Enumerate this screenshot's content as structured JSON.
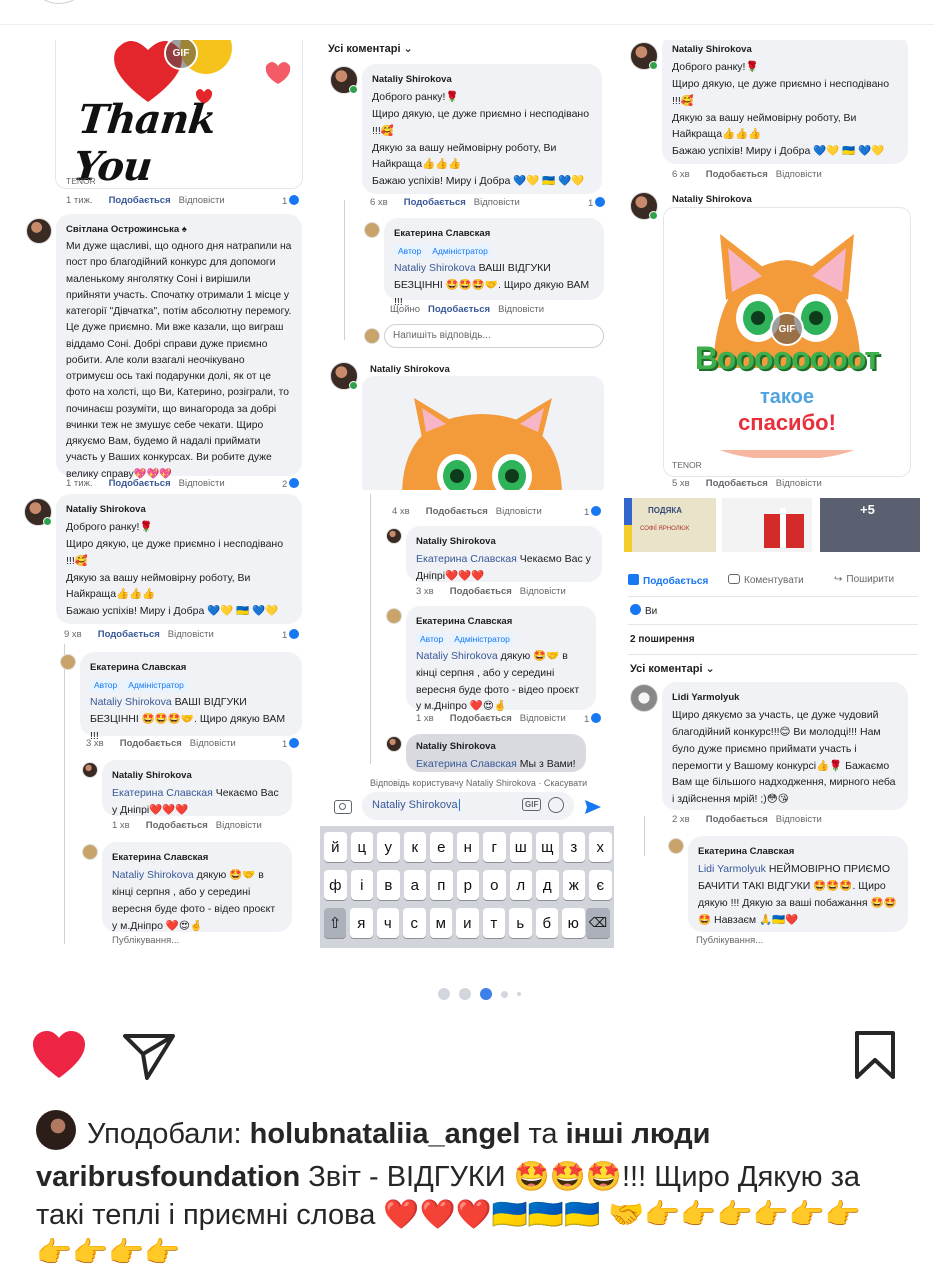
{
  "carousel": {
    "p1": {
      "tenor": "TENOR",
      "gif_label": "GIF",
      "thank_you": "Thank You",
      "meta1": {
        "time": "1 тиж.",
        "like": "Подобається",
        "reply": "Відповісти",
        "count": "1"
      },
      "comment": {
        "name": "Світлана Острожинська ♠",
        "text": "Ми дуже щасливі, що одного дня натрапили на пост про благодійний конкурс для допомоги маленькому янголятку Соні і вирішили прийняти участь.   Спочатку отримали 1 місце у категорії \"Дівчатка\", потім абсолютну перемогу. Це дуже приємно. Ми вже казали, що виграш віддамо Соні. Добрі справи дуже приємно робити. Але коли взагалі неочікувано отримуєш ось такі подарунки долі, як от це фото на холсті, що Ви, Катерино, розіграли, то починаєш розуміти, що винагорода за добрі вчинки теж не змушує себе чекати. Щиро дякуємо Вам, будемо й надалі приймати участь у Ваших конкурсах. Ви робите дуже велику справу💖💖💖"
      },
      "meta2": {
        "time": "1 тиж.",
        "like": "Подобається",
        "reply": "Відповісти",
        "count": "2"
      }
    },
    "p2": {
      "all_comments": "Усі коментарі ⌄",
      "comment": {
        "name": "Nataliy Shirokova",
        "lines": [
          "Доброго ранку!🌹",
          "Щиро дякую, це дуже приємно і несподівано !!!🥰",
          "Дякую за вашу неймовірну роботу, Ви Найкраща👍👍👍",
          "Бажаю успіхів! Миру і Добра 💙💛 🇺🇦 💙💛"
        ]
      },
      "meta1": {
        "time": "6 хв",
        "like": "Подобається",
        "reply": "Відповісти",
        "count": "1"
      },
      "reply": {
        "name": "Екатерина Славская",
        "badge1": "Автор",
        "badge2": "Адміністратор",
        "mention": "Nataliy Shirokova",
        "text": " ВАШІ ВІДГУКИ БЕЗЦІННІ 🤩🤩🤩🤝. Щиро дякую ВАМ !!!"
      },
      "meta2": {
        "time": "Щойно",
        "like": "Подобається",
        "reply": "Відповісти"
      },
      "reply_placeholder": "Напишіть відповідь...",
      "comment2_name": "Nataliy Shirokova"
    },
    "p3": {
      "comment": {
        "name": "Nataliy Shirokova",
        "lines": [
          "Доброго ранку!🌹",
          "Щиро дякую, це дуже приємно і несподівано !!!🥰",
          "Дякую за вашу неймовірну роботу, Ви Найкраща👍👍👍",
          "Бажаю успіхів! Миру і Добра 💙💛 🇺🇦 💙💛"
        ]
      },
      "meta1": {
        "time": "6 хв",
        "like": "Подобається",
        "reply": "Відповісти"
      },
      "comment2_name": "Nataliy Shirokova",
      "gif_line1": "Воооооооот",
      "gif_line2": "такое",
      "gif_line3": "спасибо!",
      "gif_label": "GIF",
      "tenor": "TENOR",
      "meta2": {
        "time": "5 хв",
        "like": "Подобається",
        "reply": "Відповісти"
      }
    },
    "p4": {
      "comment": {
        "name": "Nataliy Shirokova",
        "lines": [
          "Доброго ранку!🌹",
          "Щиро дякую, це дуже приємно і несподівано !!!🥰",
          "Дякую за вашу неймовірну роботу, Ви Найкраща👍👍👍",
          "Бажаю успіхів! Миру і Добра 💙💛 🇺🇦 💙💛"
        ]
      },
      "meta1": {
        "time": "9 хв",
        "like": "Подобається",
        "reply": "Відповісти",
        "count": "1"
      },
      "reply1": {
        "name": "Екатерина Славская",
        "badge1": "Автор",
        "badge2": "Адміністратор",
        "mention": "Nataliy Shirokova",
        "text": " ВАШІ ВІДГУКИ БЕЗЦІННІ 🤩🤩🤩🤝. Щиро дякую ВАМ !!!"
      },
      "meta2": {
        "time": "3 хв",
        "like": "Подобається",
        "reply": "Відповісти",
        "count": "1"
      },
      "reply2": {
        "name": "Nataliy Shirokova",
        "mention": "Екатерина Славская",
        "text": " Чекаємо Вас у Дніпрі❤️❤️❤️"
      },
      "meta3": {
        "time": "1 хв",
        "like": "Подобається",
        "reply": "Відповісти"
      },
      "reply3": {
        "name": "Екатерина Славская",
        "mention": "Nataliy Shirokova",
        "text": " дякую 🤩🤝 в кінці серпня , або у середині вересня буде фото - відео проєкт у м.Дніпро ❤️😍🤞"
      },
      "publishing": "Публікування..."
    },
    "p5": {
      "meta0": {
        "time": "4 хв",
        "like": "Подобається",
        "reply": "Відповісти",
        "count": "1"
      },
      "reply1": {
        "name": "Nataliy Shirokova",
        "mention": "Екатерина Славская",
        "text": " Чекаємо Вас у Дніпрі❤️❤️❤️"
      },
      "meta1": {
        "time": "3 хв",
        "like": "Подобається",
        "reply": "Відповісти"
      },
      "reply2": {
        "name": "Екатерина Славская",
        "badge1": "Автор",
        "badge2": "Адміністратор",
        "mention": "Nataliy Shirokova",
        "text": " дякую 🤩🤝 в кінці серпня , або у середині вересня буде фото - відео проєкт у м.Дніпро ❤️😍🤞"
      },
      "meta2": {
        "time": "1 хв",
        "like": "Подобається",
        "reply": "Відповісти",
        "count": "1"
      },
      "reply3": {
        "name": "Nataliy Shirokova",
        "mention": "Екатерина Славская",
        "text": " Мы з Вами!"
      },
      "replying_to": "Відповідь користувачу Nataliy Shirokova · Скасувати",
      "input_value": "Nataliy Shirokova",
      "gif": "GIF",
      "keys_row1": [
        "й",
        "ц",
        "у",
        "к",
        "е",
        "н",
        "г",
        "ш",
        "щ",
        "з",
        "х"
      ],
      "keys_row2": [
        "ф",
        "і",
        "в",
        "а",
        "п",
        "р",
        "о",
        "л",
        "д",
        "ж",
        "є"
      ],
      "keys_row3": [
        "я",
        "ч",
        "с",
        "м",
        "и",
        "т",
        "ь",
        "б",
        "ю"
      ]
    },
    "p6": {
      "thumb_more": "+5",
      "thumb_title": "ПОДЯКА",
      "thumb_name": "СОФІЇ ЯРНОЛЮК",
      "action_like": "Подобається",
      "action_comment": "Коментувати",
      "action_share": "Поширити",
      "reactions": "Ви",
      "shares": "2 поширення",
      "all_comments": "Усі коментарі ⌄",
      "comment": {
        "name": "Lidi Yarmolyuk",
        "text": "Щиро дякуємо за участь, це дуже чудовий благодійний конкурс!!!😊 Ви молодці!!! Нам було дуже приємно приймати участь і перемогти у Вашому конкурсі👍🌹 Бажаємо Вам ще більшого надходження, мирного неба і здійснення мрій! ;)😳😘"
      },
      "meta1": {
        "time": "2 хв",
        "like": "Подобається",
        "reply": "Відповісти"
      },
      "reply": {
        "name": "Екатерина Славская",
        "mention": "Lidi Yarmolyuk",
        "text": " НЕЙМОВІРНО ПРИЄМО БАЧИТИ ТАКІ ВІДГУКИ 🤩🤩🤩. Щиро дякую !!! Дякую за ваші побажання 🤩🤩🤩 Навзаєм 🙏🇺🇦❤️"
      },
      "publishing": "Публікування..."
    }
  },
  "carousel_dots": 5,
  "liked_by": {
    "prefix": "Уподобали: ",
    "user": "holubnataliia_angel",
    "middle": " та ",
    "others": "інші люди"
  },
  "caption": {
    "account": "varibrusfoundation",
    "text": " Звіт - ВІДГУКИ 🤩🤩🤩!!! Щиро Дякую за такі теплі і приємні слова ❤️❤️❤️🇺🇦🇺🇦🇺🇦 🤝👉👉👉👉👉👉👉👉👉👉"
  },
  "colors": {
    "like_red": "#ed2443",
    "fb_blue": "#1877f2",
    "fb_link": "#385898",
    "bubble": "#f0f2f5"
  }
}
